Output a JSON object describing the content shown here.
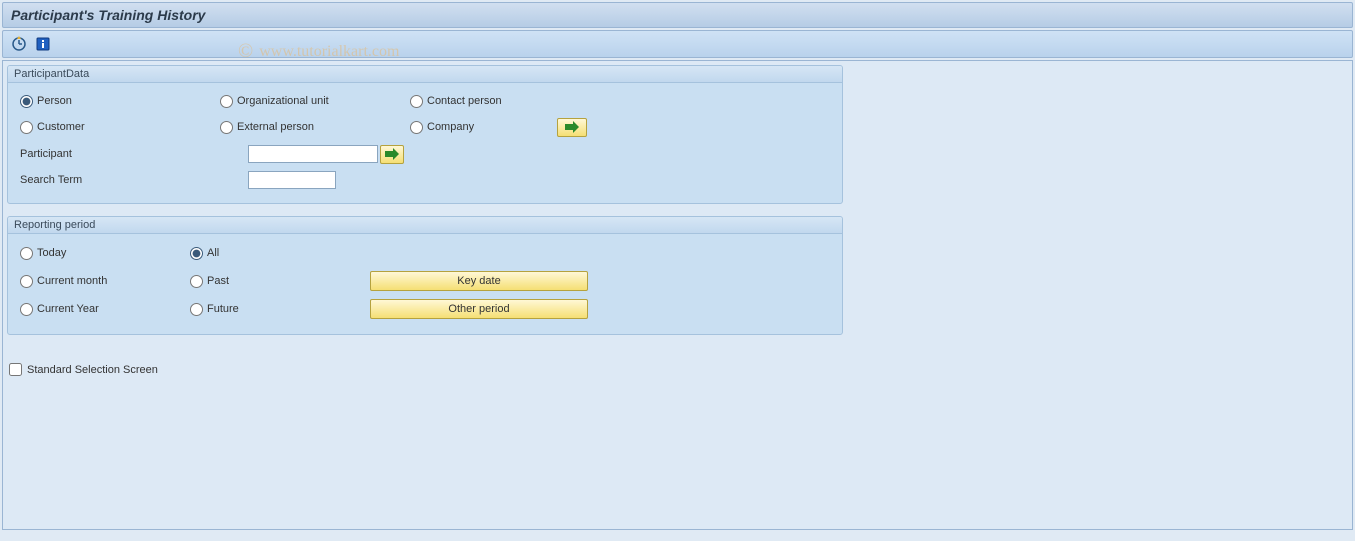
{
  "title": "Participant's Training History",
  "watermark": "© www.tutorialkart.com",
  "toolbar": {
    "execute_icon": "execute",
    "info_icon": "info"
  },
  "participantData": {
    "title": "ParticipantData",
    "radios": {
      "person": "Person",
      "orgUnit": "Organizational unit",
      "contact": "Contact person",
      "customer": "Customer",
      "external": "External person",
      "company": "Company"
    },
    "selected": "person",
    "participantLabel": "Participant",
    "participantValue": "",
    "searchLabel": "Search Term",
    "searchValue": ""
  },
  "reporting": {
    "title": "Reporting period",
    "radios": {
      "today": "Today",
      "all": "All",
      "currentMonth": "Current month",
      "past": "Past",
      "currentYear": "Current Year",
      "future": "Future"
    },
    "selected": "all",
    "buttons": {
      "keyDate": "Key date",
      "otherPeriod": "Other period"
    }
  },
  "checkbox": {
    "stdSelLabel": "Standard Selection Screen",
    "stdSelChecked": false
  }
}
